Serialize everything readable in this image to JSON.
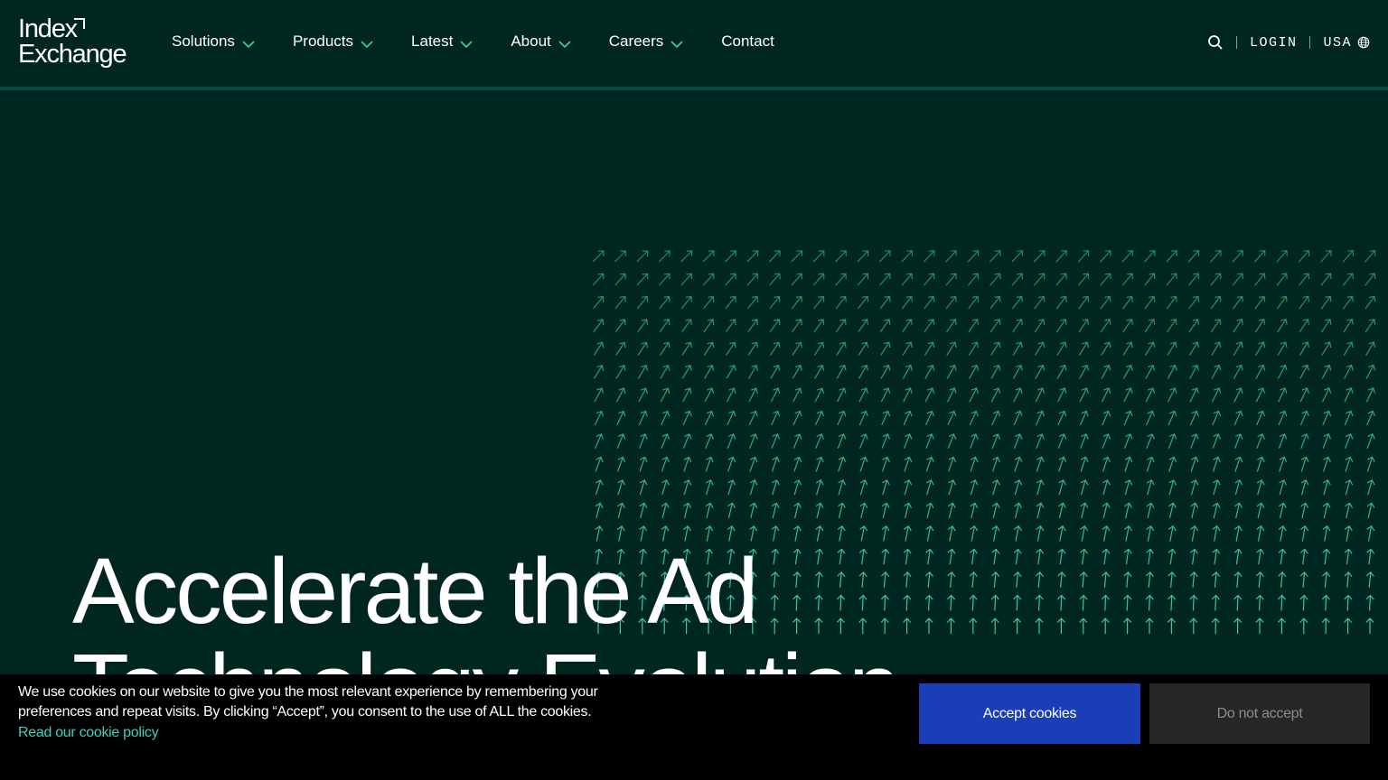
{
  "brand": {
    "line1": "Index",
    "line2": "Exchange"
  },
  "nav": {
    "items": [
      {
        "label": "Solutions",
        "has_dropdown": true
      },
      {
        "label": "Products",
        "has_dropdown": true
      },
      {
        "label": "Latest",
        "has_dropdown": true
      },
      {
        "label": "About",
        "has_dropdown": true
      },
      {
        "label": "Careers",
        "has_dropdown": true
      },
      {
        "label": "Contact",
        "has_dropdown": false
      }
    ]
  },
  "header_tools": {
    "search_icon": "search-icon",
    "login_label": "LOGIN",
    "region_label": "USA",
    "region_icon": "globe-icon"
  },
  "hero": {
    "title_line1": "Accelerate the Ad",
    "title_line2": "Technology Evolution"
  },
  "cookie_banner": {
    "message": "We use cookies on our website to give you the most relevant experience by remembering your preferences and repeat visits. By clicking “Accept”, you consent to the use of ALL the cookies.",
    "policy_link": "Read our cookie policy",
    "accept_label": "Accept cookies",
    "decline_label": "Do not accept"
  },
  "colors": {
    "background": "#002620",
    "accent_teal": "#3fd1b5",
    "accept_blue": "#1a3db8",
    "decline_gray": "#262626"
  }
}
